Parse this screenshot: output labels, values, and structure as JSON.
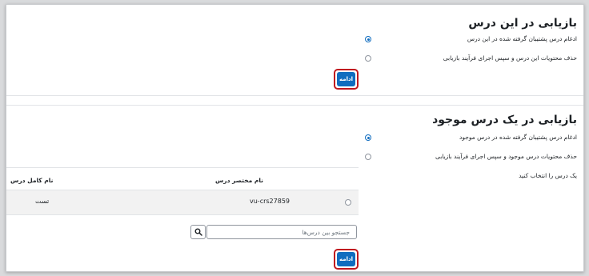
{
  "section1": {
    "title": "بازیابی در این درس",
    "options": [
      {
        "label": "ادغام درس پشتیبان گرفته شده در این درس",
        "selected": true
      },
      {
        "label": "حذف محتویات این درس و سپس اجرای فرآیند بازیابی",
        "selected": false
      }
    ],
    "continue_label": "ادامه"
  },
  "section2": {
    "title": "بازیابی در یک درس موجود",
    "options": [
      {
        "label": "ادغام درس پشتیبان گرفته شده در درس موجود",
        "selected": true
      },
      {
        "label": "حذف محتویات درس موجود و سپس اجرای فرآیند بازیابی",
        "selected": false
      }
    ],
    "select_course_label": "یک درس را انتخاب کنید",
    "table": {
      "headers": {
        "shortname": "نام مختصر درس",
        "fullname": "نام کامل درس"
      },
      "rows": [
        {
          "shortname": "vu-crs27859",
          "fullname": "تست",
          "selected": false
        }
      ]
    },
    "search_placeholder": "جستجو بین درس‌ها",
    "continue_label": "ادامه"
  },
  "colors": {
    "accent": "#0f6cbf",
    "highlight": "#c0181f"
  },
  "icons": {
    "search": "search-icon"
  }
}
